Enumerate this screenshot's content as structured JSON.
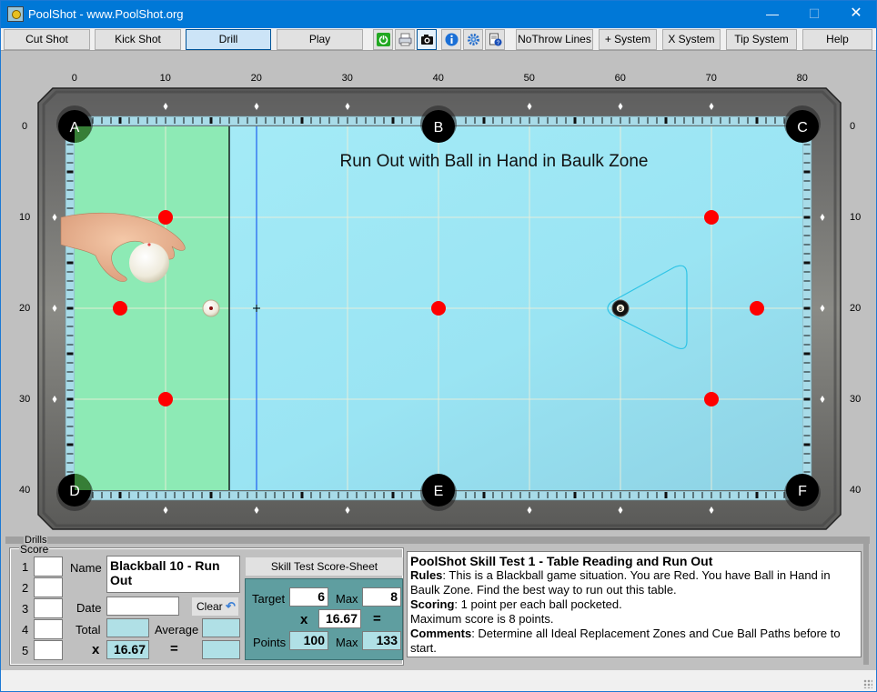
{
  "window": {
    "title": "PoolShot - www.PoolShot.org",
    "controls": {
      "minimize": "—",
      "maximize": "☐",
      "close": "✕"
    }
  },
  "toolbar": {
    "mode_buttons": [
      {
        "label": "Cut Shot",
        "active": false
      },
      {
        "label": "Kick Shot",
        "active": false
      },
      {
        "label": "Drill",
        "active": true
      },
      {
        "label": "Play",
        "active": false
      }
    ],
    "icon_buttons": [
      {
        "icon": "power-icon"
      },
      {
        "icon": "printer-icon"
      },
      {
        "icon": "camera-icon",
        "active": true
      },
      {
        "icon": "info-icon"
      },
      {
        "icon": "gear-icon"
      },
      {
        "icon": "help-document-icon"
      }
    ],
    "right_buttons": [
      {
        "label": "NoThrow Lines"
      },
      {
        "label": "+ System"
      },
      {
        "label": "X System"
      },
      {
        "label": "Tip System"
      },
      {
        "label": "Help"
      }
    ]
  },
  "table": {
    "title": "Run Out with Ball in Hand in Baulk Zone",
    "x_ticks": [
      "0",
      "10",
      "20",
      "30",
      "40",
      "50",
      "60",
      "70",
      "80"
    ],
    "y_ticks_left": [
      "0",
      "10",
      "20",
      "30",
      "40"
    ],
    "y_ticks_right": [
      "0",
      "10",
      "20",
      "30",
      "40"
    ],
    "pockets": [
      {
        "label": "A",
        "pos": [
          0,
          0
        ]
      },
      {
        "label": "B",
        "pos": [
          40,
          0
        ]
      },
      {
        "label": "C",
        "pos": [
          80,
          0
        ]
      },
      {
        "label": "D",
        "pos": [
          0,
          40
        ]
      },
      {
        "label": "E",
        "pos": [
          40,
          40
        ]
      },
      {
        "label": "F",
        "pos": [
          80,
          40
        ]
      }
    ],
    "baulk_line_x": 17,
    "aim_line_x": 20,
    "red_balls": [
      [
        10,
        10
      ],
      [
        5,
        20
      ],
      [
        10,
        30
      ],
      [
        40,
        20
      ],
      [
        70,
        10
      ],
      [
        75,
        20
      ],
      [
        70,
        30
      ]
    ],
    "black_ball": {
      "label": "8",
      "pos": [
        60,
        20
      ]
    },
    "cue_ball": [
      15,
      20
    ],
    "ball_in_hand": [
      7.5,
      15
    ],
    "colors": {
      "baulk_zone": "#8deab5",
      "cloth": "#9de6f4",
      "red_ball": "#ff0000",
      "rack_outline": "#2ec4e6",
      "pocket_highlight": "#3c8c3c"
    }
  },
  "drills": {
    "legend": "Drills",
    "score": {
      "legend": "Score",
      "rows": [
        "1",
        "2",
        "3",
        "4",
        "5"
      ],
      "name_label": "Name",
      "name_value": "Blackball 10 - Run Out",
      "date_label": "Date",
      "date_value": "",
      "clear_label": "Clear",
      "total_label": "Total",
      "total_value": "",
      "average_label": "Average",
      "average_value": "",
      "x_label": "x",
      "multiplier": "16.67",
      "equals": "=",
      "result_value": ""
    },
    "skill_sheet": {
      "button_label": "Skill Test Score-Sheet",
      "target_label": "Target",
      "target_value": "6",
      "max_label": "Max",
      "max_value": "8",
      "x_label": "x",
      "multiplier": "16.67",
      "equals": "=",
      "points_label": "Points",
      "points_value": "100",
      "points_max_label": "Max",
      "points_max_value": "133"
    },
    "info": {
      "heading": "PoolShot Skill Test 1 - Table Reading and Run Out",
      "rules_label": "Rules",
      "rules_text": ": This is a Blackball game situation. You are Red. You have Ball in Hand in Baulk Zone. Find the best way to run out this table.",
      "scoring_label": "Scoring",
      "scoring_text": ": 1 point per each ball pocketed.",
      "max_text": "Maximum score is 8 points.",
      "comments_label": "Comments",
      "comments_text": ": Determine all Ideal Replacement Zones and Cue Ball Paths before to start."
    }
  }
}
